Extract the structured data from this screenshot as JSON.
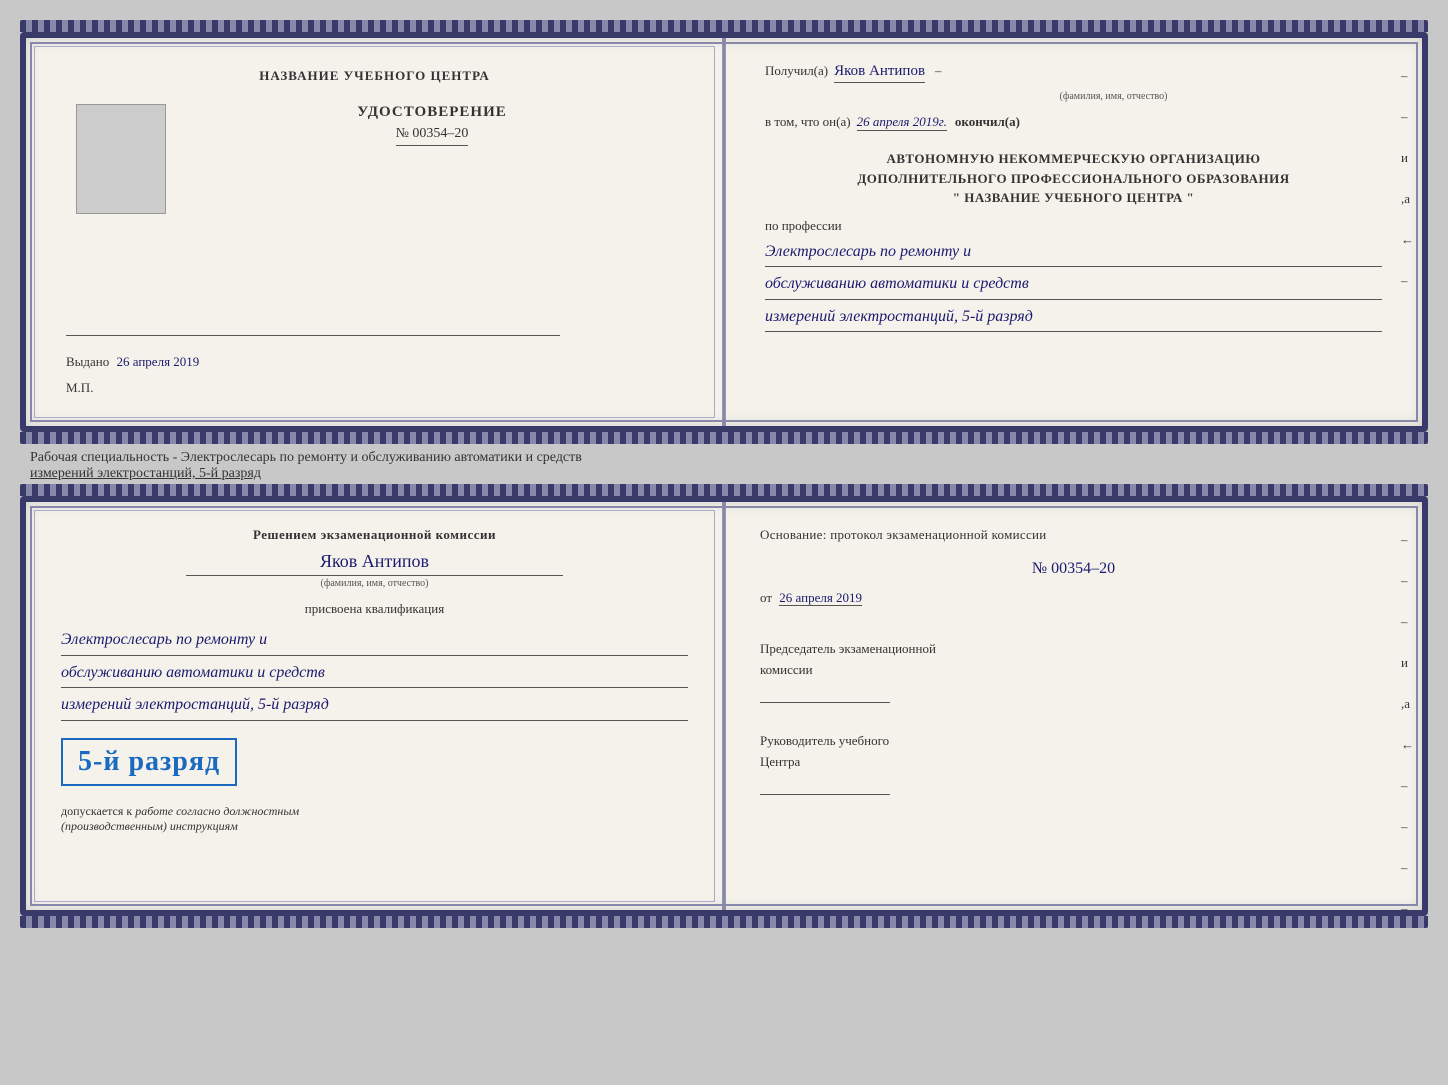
{
  "top_doc": {
    "left_page": {
      "org_title": "НАЗВАНИЕ УЧЕБНОГО ЦЕНТРА",
      "cert_type": "УДОСТОВЕРЕНИЕ",
      "cert_number": "№ 00354–20",
      "issued_label": "Выдано",
      "issued_date": "26 апреля 2019",
      "stamp_label": "М.П."
    },
    "right_page": {
      "received_label": "Получил(а)",
      "recipient_name": "Яков Антипов",
      "fio_subtitle": "(фамилия, имя, отчество)",
      "in_that_label": "в том, что он(а)",
      "completion_date": "26 апреля 2019г.",
      "completed_label": "окончил(а)",
      "org_line1": "АВТОНОМНУЮ НЕКОММЕРЧЕСКУЮ ОРГАНИЗАЦИЮ",
      "org_line2": "ДОПОЛНИТЕЛЬНОГО ПРОФЕССИОНАЛЬНОГО ОБРАЗОВАНИЯ",
      "org_line3": "\"  НАЗВАНИЕ УЧЕБНОГО ЦЕНТРА  \"",
      "profession_label": "по профессии",
      "profession_line1": "Электрослесарь по ремонту и",
      "profession_line2": "обслуживанию автоматики и средств",
      "profession_line3": "измерений электростанций, 5-й разряд",
      "side_marks": [
        "–",
        "–",
        "и",
        ",а",
        "←",
        "–"
      ]
    }
  },
  "middle_text": "Рабочая специальность - Электрослесарь по ремонту и обслуживанию автоматики и средств",
  "middle_text2": "измерений электростанций, 5-й разряд",
  "bottom_doc": {
    "left_page": {
      "decision_text": "Решением экзаменационной комиссии",
      "name": "Яков Антипов",
      "fio_subtitle": "(фамилия, имя, отчество)",
      "assigned_label": "присвоена квалификация",
      "qualification_line1": "Электрослесарь по ремонту и",
      "qualification_line2": "обслуживанию автоматики и средств",
      "qualification_line3": "измерений электростанций, 5-й разряд",
      "rank_label": "5-й разряд",
      "допускается_label": "допускается к",
      "допускается_text": "работе согласно должностным",
      "допускается_text2": "(производственным) инструкциям"
    },
    "right_page": {
      "basis_label": "Основание: протокол экзаменационной комиссии",
      "protocol_number": "№  00354–20",
      "date_prefix": "от",
      "date_value": "26 апреля 2019",
      "chairman_title": "Председатель экзаменационной",
      "chairman_title2": "комиссии",
      "director_title": "Руководитель учебного",
      "director_title2": "Центра",
      "side_marks": [
        "–",
        "–",
        "–",
        "и",
        ",а",
        "←",
        "–",
        "–",
        "–",
        "–"
      ]
    }
  }
}
